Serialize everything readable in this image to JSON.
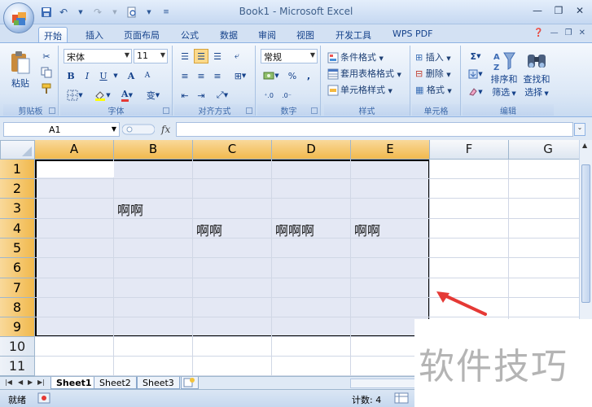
{
  "window": {
    "title": "Book1 - Microsoft Excel",
    "qat_icons": [
      "save-icon",
      "undo-icon",
      "redo-icon",
      "print-preview-icon",
      "customize-qat-icon"
    ]
  },
  "tabs": [
    {
      "label": "开始",
      "active": true
    },
    {
      "label": "插入"
    },
    {
      "label": "页面布局"
    },
    {
      "label": "公式"
    },
    {
      "label": "数据"
    },
    {
      "label": "审阅"
    },
    {
      "label": "视图"
    },
    {
      "label": "开发工具"
    },
    {
      "label": "WPS PDF"
    }
  ],
  "ribbon": {
    "clipboard": {
      "label": "剪贴板",
      "paste": "粘贴"
    },
    "font": {
      "label": "字体",
      "name": "宋体",
      "size": "11",
      "bold": "B",
      "italic": "I",
      "underline": "U",
      "grow": "A",
      "shrink": "A",
      "font_color_letter": "A",
      "phonetic": "变"
    },
    "alignment": {
      "label": "对齐方式"
    },
    "number": {
      "label": "数字",
      "format": "常规",
      "percent": "%",
      "comma": ","
    },
    "styles": {
      "label": "样式",
      "conditional": "条件格式",
      "table": "套用表格格式",
      "cell": "单元格样式"
    },
    "cells": {
      "label": "单元格",
      "insert": "插入",
      "delete": "删除",
      "format": "格式"
    },
    "editing": {
      "label": "编辑",
      "sort_l1": "排序和",
      "sort_l2": "筛选",
      "find_l1": "查找和",
      "find_l2": "选择",
      "sigma": "Σ"
    }
  },
  "formula_bar": {
    "name_box": "A1",
    "fx": "fx",
    "value": ""
  },
  "columns": [
    "A",
    "B",
    "C",
    "D",
    "E",
    "F",
    "G"
  ],
  "rows": [
    "1",
    "2",
    "3",
    "4",
    "5",
    "6",
    "7",
    "8",
    "9",
    "10",
    "11"
  ],
  "cells": {
    "B3": "啊啊",
    "C4": "啊啊",
    "D4": "啊啊啊",
    "E4": "啊啊"
  },
  "sheets": [
    "Sheet1",
    "Sheet2",
    "Sheet3"
  ],
  "status": {
    "ready": "就绪",
    "count": "计数: 4"
  },
  "watermark": "软件技巧",
  "colors": {
    "selection_header": "#f1b94d",
    "selection_fill": "#e4e8f4",
    "arrow": "#e53935"
  }
}
